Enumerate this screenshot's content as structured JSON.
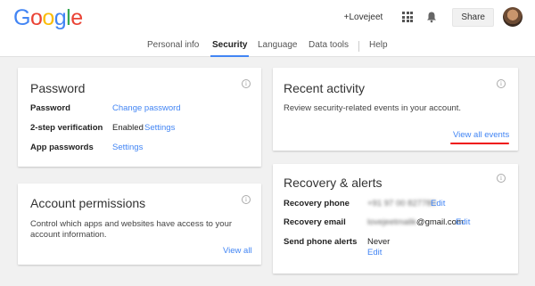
{
  "header": {
    "logo_letters": [
      "G",
      "o",
      "o",
      "g",
      "l",
      "e"
    ],
    "logo_colors": [
      "#4285f4",
      "#ea4335",
      "#fbbc05",
      "#4285f4",
      "#34a853",
      "#ea4335"
    ],
    "user_name": "+Lovejeet",
    "share_label": "Share",
    "icons": [
      "apps-grid-icon",
      "notifications-bell-icon"
    ]
  },
  "nav": {
    "tabs": [
      {
        "label": "Personal info",
        "active": false
      },
      {
        "label": "Security",
        "active": true
      },
      {
        "label": "Language",
        "active": false
      },
      {
        "label": "Data tools",
        "active": false
      },
      {
        "label": "Help",
        "active": false
      }
    ]
  },
  "password_card": {
    "title": "Password",
    "rows": [
      {
        "label": "Password",
        "link": "Change password"
      },
      {
        "label": "2-step verification",
        "value": "Enabled",
        "link": "Settings"
      },
      {
        "label": "App passwords",
        "link": "Settings"
      }
    ]
  },
  "permissions_card": {
    "title": "Account permissions",
    "description": "Control which apps and websites have access to your account information.",
    "link": "View all"
  },
  "activity_card": {
    "title": "Recent activity",
    "description": "Review security-related events in your account.",
    "link": "View all events",
    "highlight_color": "#e11111"
  },
  "recovery_card": {
    "title": "Recovery & alerts",
    "rows": [
      {
        "label": "Recovery phone",
        "value_blurred": "+91 97 00 827780",
        "link": "Edit"
      },
      {
        "label": "Recovery email",
        "value_blurred": "lovejeetmalik",
        "value_suffix": "@gmail.com",
        "link": "Edit"
      },
      {
        "label": "Send phone alerts",
        "value": "Never",
        "link": "Edit"
      }
    ]
  },
  "info_icon_glyph": "i"
}
